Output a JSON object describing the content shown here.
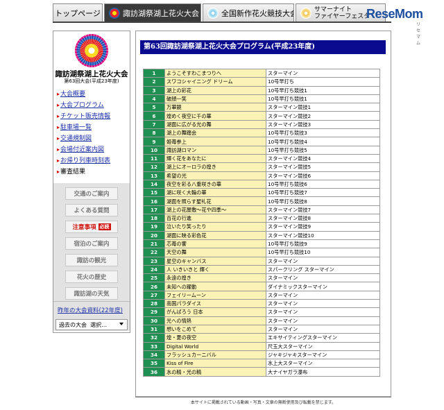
{
  "tabs": [
    {
      "label": "トップページ",
      "active": false
    },
    {
      "label": "諏訪湖祭湖上花火大会",
      "active": true
    },
    {
      "label": "全国新作花火競技大会",
      "active": false
    },
    {
      "label_line1": "サマーナイト",
      "label_line2": "ファイヤーフェスタ",
      "active": false
    }
  ],
  "brand_logo": {
    "text": "ReseMom",
    "sub": "リセマム"
  },
  "sidebar": {
    "title": "諏訪湖祭湖上花火大会",
    "subtitle": "第63回大会(平成23年度)",
    "links": [
      {
        "label": "大会概要",
        "linked": true
      },
      {
        "label": "大会プログラム",
        "linked": true
      },
      {
        "label": "チケット販売情報",
        "linked": true
      },
      {
        "label": "駐車場一覧",
        "linked": true
      },
      {
        "label": "交通規制図",
        "linked": true
      },
      {
        "label": "会場付近案内図",
        "linked": true
      },
      {
        "label": "お帰り列車時刻表",
        "linked": true
      },
      {
        "label": "審査結果",
        "linked": false
      }
    ],
    "buttons": [
      {
        "label": "交通のご案内"
      },
      {
        "label": "よくある質問"
      },
      {
        "label": "注意事項",
        "badge": "必読"
      },
      {
        "label": "宿泊のご案内"
      },
      {
        "label": "諏訪の観光"
      },
      {
        "label": "花火の歴史"
      },
      {
        "label": "諏訪湖の天気"
      }
    ],
    "prev_link": "昨年の大会資料(22年度)",
    "past_select": {
      "label": "過去の大会",
      "value": "選択…"
    }
  },
  "main": {
    "title": "第63回諏訪湖祭湖上花火大会プログラム(平成23年度)",
    "rows": [
      {
        "no": "1",
        "title": "ようこそすわこまつりへ",
        "kind": "スターマイン"
      },
      {
        "no": "2",
        "title": "スワコシャイニング ドリーム",
        "kind": "10号早打ち"
      },
      {
        "no": "3",
        "title": "湖上の彩花",
        "kind": "10号早打ち競技1"
      },
      {
        "no": "4",
        "title": "破顔一笑",
        "kind": "10号早打ち競技1"
      },
      {
        "no": "5",
        "title": "万華鏡",
        "kind": "スターマイン競技1"
      },
      {
        "no": "6",
        "title": "煌めく夜空に千の華",
        "kind": "スターマイン競技2"
      },
      {
        "no": "7",
        "title": "湖面に広がる光の舞",
        "kind": "スターマイン競技3"
      },
      {
        "no": "8",
        "title": "湖上の舞踏会",
        "kind": "10号早打ち競技3"
      },
      {
        "no": "9",
        "title": "姫苺参上",
        "kind": "10号早打ち競技4"
      },
      {
        "no": "10",
        "title": "諏訪湖ロマン",
        "kind": "10号早打ち競技5"
      },
      {
        "no": "11",
        "title": "輝く花をあなたに",
        "kind": "スターマイン競技4"
      },
      {
        "no": "12",
        "title": "湖上にオーロラの煌き",
        "kind": "スターマイン競技5"
      },
      {
        "no": "13",
        "title": "希望の光",
        "kind": "スターマイン競技6"
      },
      {
        "no": "14",
        "title": "夜空を彩る八重咲きの華",
        "kind": "10号早打ち競技6"
      },
      {
        "no": "15",
        "title": "湖に咲く大輪の華",
        "kind": "10号早打ち競技7"
      },
      {
        "no": "16",
        "title": "湖面を照らす聖礼花",
        "kind": "10号早打ち競技8"
      },
      {
        "no": "17",
        "title": "湖上の花屋敷～花や四季～",
        "kind": "スターマイン競技7"
      },
      {
        "no": "18",
        "title": "百花の行進",
        "kind": "スターマイン競技8"
      },
      {
        "no": "19",
        "title": "泣いたり笑ったり",
        "kind": "スターマイン競技9"
      },
      {
        "no": "20",
        "title": "湖面に映る彩色花",
        "kind": "スターマイン競技10"
      },
      {
        "no": "21",
        "title": "芯苺の饗",
        "kind": "10号早打ち競技9"
      },
      {
        "no": "22",
        "title": "天空の舞",
        "kind": "10号早打ち競技10"
      },
      {
        "no": "23",
        "title": "星空のキャンバス",
        "kind": "スターマイン"
      },
      {
        "no": "24",
        "title": "人 いきいきと 輝く",
        "kind": "スパークリング スターマイン"
      },
      {
        "no": "25",
        "title": "永遠の煌き",
        "kind": "スターマイン"
      },
      {
        "no": "26",
        "title": "未知への躍動",
        "kind": "ダイナミックスターマイン"
      },
      {
        "no": "27",
        "title": "フェイリームーン",
        "kind": "スターマイン"
      },
      {
        "no": "28",
        "title": "南国パラダイス",
        "kind": "スターマイン"
      },
      {
        "no": "29",
        "title": "がんばろう 日本",
        "kind": "スターマイン"
      },
      {
        "no": "30",
        "title": "光への情熱",
        "kind": "スターマイン"
      },
      {
        "no": "31",
        "title": "想いをこめて",
        "kind": "スターマイン"
      },
      {
        "no": "32",
        "title": "煌・夏の夜空",
        "kind": "エキサイティングスターマイン"
      },
      {
        "no": "33",
        "title": "Digital World",
        "kind": "尺玉大スターマイン"
      },
      {
        "no": "34",
        "title": "フラッシュカーニバル",
        "kind": "ジャキジャキスターマイン"
      },
      {
        "no": "35",
        "title": "Kiss of Fire",
        "kind": "水上大スターマイン"
      },
      {
        "no": "36",
        "title": "水の精・光の精",
        "kind": "大ナイヤガラ瀑布"
      }
    ]
  },
  "footer": "本サイトに掲載されている動画・写真・文章の無断使用及び転載を禁じます。",
  "colors": {
    "title_bg": "#0b0b8f",
    "number_bg": "#1f8f52",
    "program_bg": "#fbf3b6",
    "link": "#1a2ea8"
  }
}
